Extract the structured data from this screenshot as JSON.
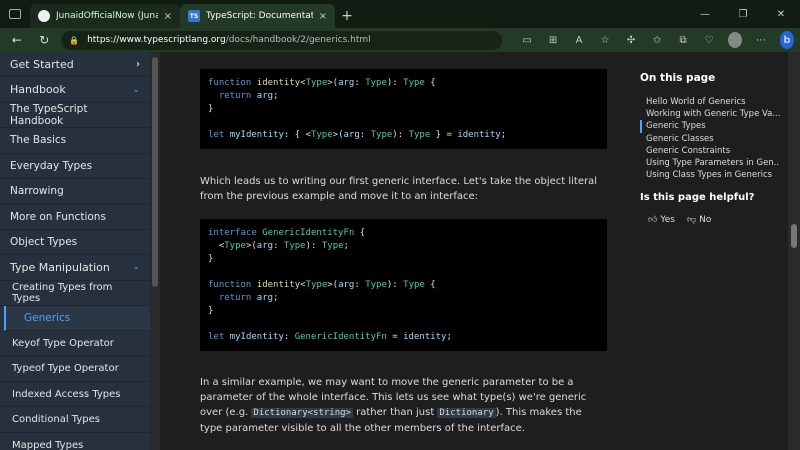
{
  "browser": {
    "tabs": [
      {
        "title": "JunaidOfficialNow (Junaid)",
        "icon": "github-icon"
      },
      {
        "title": "TypeScript: Documentation - Ge",
        "icon": "typescript-icon",
        "icon_text": "TS"
      }
    ],
    "close_glyph": "×",
    "new_tab_glyph": "+",
    "window_controls": [
      "—",
      "❐",
      "✕"
    ],
    "url_host": "https://www.typescriptlang.org",
    "url_path": "/docs/handbook/2/generics.html"
  },
  "sidebar": {
    "items": [
      {
        "label": "Get Started"
      },
      {
        "label": "Handbook"
      },
      {
        "label": "The TypeScript Handbook"
      },
      {
        "label": "The Basics"
      },
      {
        "label": "Everyday Types"
      },
      {
        "label": "Narrowing"
      },
      {
        "label": "More on Functions"
      },
      {
        "label": "Object Types"
      },
      {
        "label": "Type Manipulation"
      },
      {
        "label": "Creating Types from Types"
      },
      {
        "label": "Generics"
      },
      {
        "label": "Keyof Type Operator"
      },
      {
        "label": "Typeof Type Operator"
      },
      {
        "label": "Indexed Access Types"
      },
      {
        "label": "Conditional Types"
      },
      {
        "label": "Mapped Types"
      }
    ]
  },
  "main": {
    "para1": "Which leads us to writing our first generic interface. Let's take the object literal from the previous example and move it to an interface:",
    "para2_a": "In a similar example, we may want to move the generic parameter to be a parameter of the whole interface. This lets us see what type(s) we're generic over (e.g. ",
    "para2_code1": "Dictionary<string>",
    "para2_b": " rather than just ",
    "para2_code2": "Dictionary",
    "para2_c": "). This makes the type parameter visible to all the other members of the interface."
  },
  "toc": {
    "title": "On this page",
    "items": [
      "Hello World of Generics",
      "Working with Generic Type Va...",
      "Generic Types",
      "Generic Classes",
      "Generic Constraints",
      "Using Type Parameters in Gen...",
      "Using Class Types in Generics"
    ],
    "helpful_title": "Is this page helpful?",
    "yes": "Yes",
    "no": "No"
  },
  "colors": {
    "accent": "#4aa3ff",
    "sidebar_bg": "#26313d",
    "code_bg": "#000000"
  }
}
